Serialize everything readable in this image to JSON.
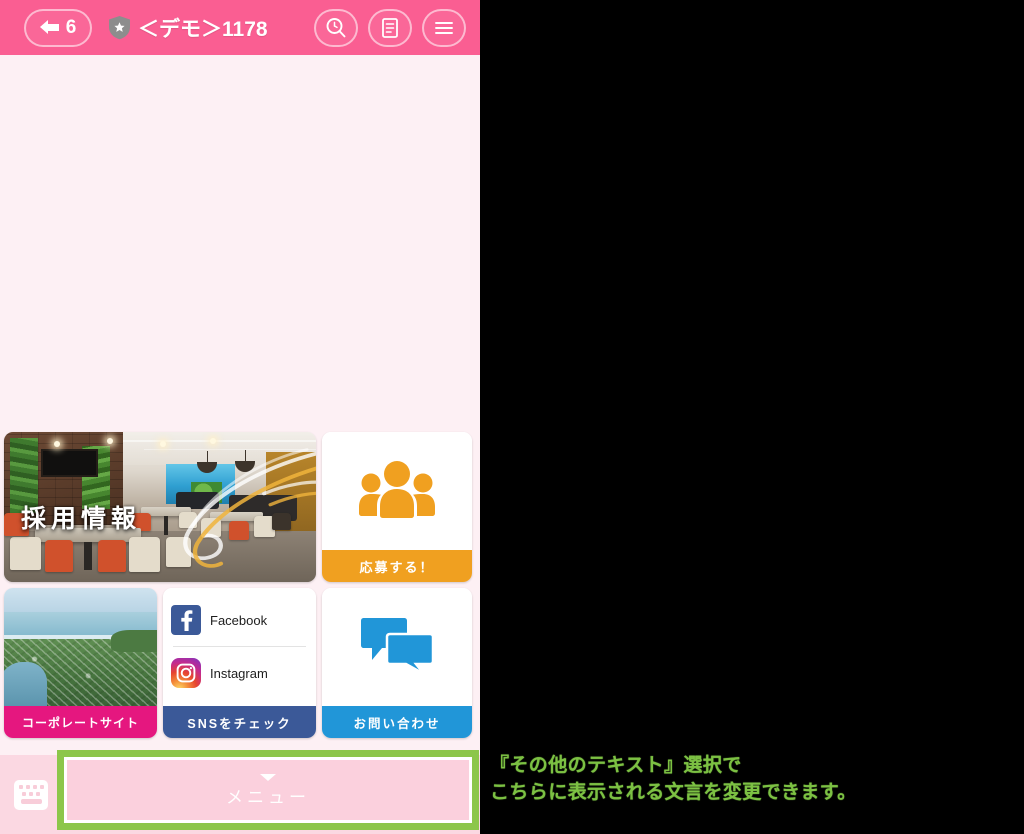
{
  "header": {
    "back_count": "6",
    "title": "＜デモ＞1178",
    "shield_icon": "shield-star-icon",
    "actions": [
      {
        "name": "search-icon",
        "label": "検索"
      },
      {
        "name": "document-icon",
        "label": "ノート"
      },
      {
        "name": "menu-icon",
        "label": "メニュー"
      }
    ],
    "bg_color": "#fa5e92"
  },
  "content": {
    "bg_color": "#fdf0f4"
  },
  "tiles": {
    "recruit": {
      "overlay_text": "採用情報",
      "image_alt": "オフィスラウンジの内装写真"
    },
    "apply": {
      "footer_label": "応募する！",
      "icon": "people-group-icon",
      "accent_color": "#f0a020"
    },
    "corporate": {
      "footer_label": "コーポレートサイト",
      "image_alt": "海岸線の航空写真",
      "accent_color": "#e5177f"
    },
    "sns": {
      "footer_label": "SNSをチェック",
      "accent_color": "#3b5998",
      "links": [
        {
          "icon": "facebook-icon",
          "label": "Facebook"
        },
        {
          "icon": "instagram-icon",
          "label": "Instagram"
        }
      ]
    },
    "contact": {
      "footer_label": "お問い合わせ",
      "icon": "chat-bubbles-icon",
      "accent_color": "#2196d8"
    }
  },
  "footer": {
    "keyboard_icon": "keyboard-icon",
    "menu_label": "メニュー",
    "menu_caret": "caret-down-icon",
    "bg_color": "#fbd8e2"
  },
  "annotation": {
    "highlight_color": "#8cc64a",
    "text_color": "#7cc143",
    "line1": "『その他のテキスト』選択で",
    "line2": "こちらに表示される文言を変更できます。"
  }
}
